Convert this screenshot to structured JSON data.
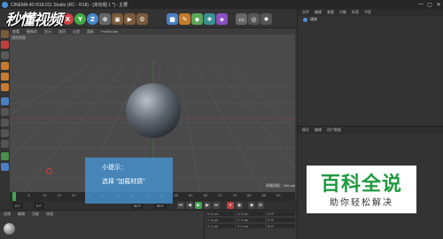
{
  "window": {
    "title": "CINEMA 4D R18.011 Studio (RC - R18) - [未标题 1 *] - 主要",
    "controls": [
      "—",
      "▢",
      "✕"
    ]
  },
  "watermark": {
    "text": "秒懂视频"
  },
  "toolbar": {
    "buttons": [
      {
        "name": "undo-icon",
        "glyph": "↶",
        "color": "#5a5a5a"
      },
      {
        "name": "redo-icon",
        "glyph": "↷",
        "color": "#5a5a5a"
      },
      {
        "name": "x-axis-icon",
        "glyph": "X",
        "color": "#c44"
      },
      {
        "name": "y-axis-icon",
        "glyph": "Y",
        "color": "#4a4"
      },
      {
        "name": "z-axis-icon",
        "glyph": "Z",
        "color": "#48c"
      },
      {
        "name": "coord-icon",
        "glyph": "⊕",
        "color": "#666"
      },
      {
        "name": "render-region-icon",
        "glyph": "▣",
        "color": "#7a5a3a"
      },
      {
        "name": "render-view-icon",
        "glyph": "▶",
        "color": "#7a5a3a"
      },
      {
        "name": "render-settings-icon",
        "glyph": "⚙",
        "color": "#7a5a3a"
      },
      {
        "name": "cube-icon",
        "glyph": "■",
        "color": "#4a7fc0"
      },
      {
        "name": "pen-icon",
        "glyph": "✎",
        "color": "#c57a2a"
      },
      {
        "name": "subdivision-icon",
        "glyph": "◆",
        "color": "#5aa55a"
      },
      {
        "name": "array-icon",
        "glyph": "❖",
        "color": "#3a8f8f"
      },
      {
        "name": "deformer-icon",
        "glyph": "◈",
        "color": "#8a4fc0"
      },
      {
        "name": "floor-icon",
        "glyph": "▭",
        "color": "#666"
      },
      {
        "name": "camera-icon",
        "glyph": "◎",
        "color": "#555"
      },
      {
        "name": "light-icon",
        "glyph": "✹",
        "color": "#555"
      }
    ]
  },
  "viewport": {
    "menus": [
      "查看",
      "摄像机",
      "显示",
      "选项",
      "过滤",
      "面板",
      "ProRender"
    ],
    "label": "透视视图",
    "hud": "网格间距：100 cm"
  },
  "objects_panel": {
    "tabs": [
      "文件",
      "编辑",
      "查看",
      "对象",
      "标签",
      "书签"
    ],
    "objects": [
      {
        "name": "球体"
      }
    ]
  },
  "attributes_panel": {
    "tabs": [
      "模式",
      "编辑",
      "用户数据"
    ]
  },
  "timeline": {
    "ticks": [
      "0",
      "5",
      "10",
      "15",
      "20",
      "25",
      "30",
      "35",
      "40",
      "45",
      "50",
      "55",
      "60",
      "65",
      "70",
      "75",
      "80",
      "85",
      "90"
    ],
    "start_frame": "0 F",
    "start_field": "0 F",
    "end_field": "90 F",
    "end_frame": "90 F",
    "current": "0 F"
  },
  "materials": {
    "tabs": [
      "创建",
      "编辑",
      "功能",
      "纹理"
    ]
  },
  "coordinates": {
    "rows": [
      [
        "X 0 cm",
        "X 0 cm",
        "H 0°"
      ],
      [
        "Y 0 cm",
        "Y 0 cm",
        "P 0°"
      ],
      [
        "Z 0 cm",
        "Z 0 cm",
        "B 0°"
      ]
    ]
  },
  "tip": {
    "title": "小提示：",
    "body": "选择 “加载材质”"
  },
  "brand": {
    "name": "百科全说",
    "slogan": "助你轻松解决"
  },
  "colors": {
    "tip_box": "#4696d7",
    "brand_green": "#1f9a3f",
    "viewport_bg": "#4a4a4a"
  }
}
